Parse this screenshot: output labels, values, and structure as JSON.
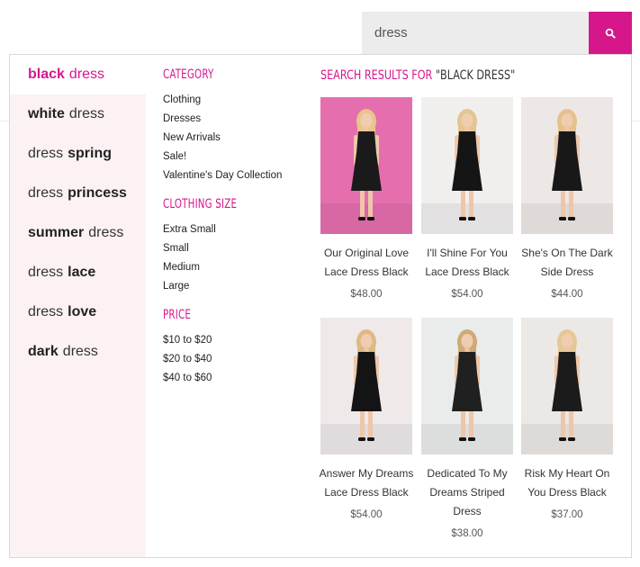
{
  "search": {
    "value": "dress"
  },
  "suggestions": [
    {
      "parts": [
        {
          "text": "black",
          "bold": true
        },
        {
          "text": "dress",
          "bold": false
        }
      ],
      "active": true
    },
    {
      "parts": [
        {
          "text": "white",
          "bold": true
        },
        {
          "text": "dress",
          "bold": false
        }
      ],
      "active": false
    },
    {
      "parts": [
        {
          "text": "dress",
          "bold": false
        },
        {
          "text": "spring",
          "bold": true
        }
      ],
      "active": false
    },
    {
      "parts": [
        {
          "text": "dress",
          "bold": false
        },
        {
          "text": "princess",
          "bold": true
        }
      ],
      "active": false
    },
    {
      "parts": [
        {
          "text": "summer",
          "bold": true
        },
        {
          "text": "dress",
          "bold": false
        }
      ],
      "active": false
    },
    {
      "parts": [
        {
          "text": "dress",
          "bold": false
        },
        {
          "text": "lace",
          "bold": true
        }
      ],
      "active": false
    },
    {
      "parts": [
        {
          "text": "dress",
          "bold": false
        },
        {
          "text": "love",
          "bold": true
        }
      ],
      "active": false
    },
    {
      "parts": [
        {
          "text": "dark",
          "bold": true
        },
        {
          "text": "dress",
          "bold": false
        }
      ],
      "active": false
    }
  ],
  "facets": [
    {
      "heading": "Category",
      "items": [
        "Clothing",
        "Dresses",
        "New Arrivals",
        "Sale!",
        "Valentine's Day Collection"
      ]
    },
    {
      "heading": "Clothing Size",
      "items": [
        "Extra Small",
        "Small",
        "Medium",
        "Large"
      ]
    },
    {
      "heading": "Price",
      "items": [
        "$10 to $20",
        "$20 to $40",
        "$40 to $60"
      ]
    }
  ],
  "results": {
    "label": "Search results for",
    "query": "\"black dress\""
  },
  "products": [
    {
      "name": "Our Original Love Lace Dress Black",
      "price": "$48.00",
      "bg": "#e56fae",
      "dress": "#1a1a1a",
      "hair": "#e8c58a"
    },
    {
      "name": "I'll Shine For You Lace Dress Black",
      "price": "$54.00",
      "bg": "#f1efee",
      "dress": "#151515",
      "hair": "#e2c58f"
    },
    {
      "name": "She's On The Dark Side Dress",
      "price": "$44.00",
      "bg": "#ede7e6",
      "dress": "#181818",
      "hair": "#e3c28c"
    },
    {
      "name": "Answer My Dreams Lace Dress Black",
      "price": "$54.00",
      "bg": "#efe9ea",
      "dress": "#141414",
      "hair": "#ddb985"
    },
    {
      "name": "Dedicated To My Dreams Striped Dress",
      "price": "$38.00",
      "bg": "#e9ecea",
      "dress": "#202020",
      "hair": "#cfa978"
    },
    {
      "name": "Risk My Heart On You Dress Black",
      "price": "$37.00",
      "bg": "#ebe8e6",
      "dress": "#1b1b1b",
      "hair": "#e5c995"
    }
  ],
  "colors": {
    "accent": "#d6178c",
    "suggestion_bg": "#fcf2f3",
    "search_bg": "#ececec"
  },
  "icons": {
    "search_button": "search-icon"
  }
}
